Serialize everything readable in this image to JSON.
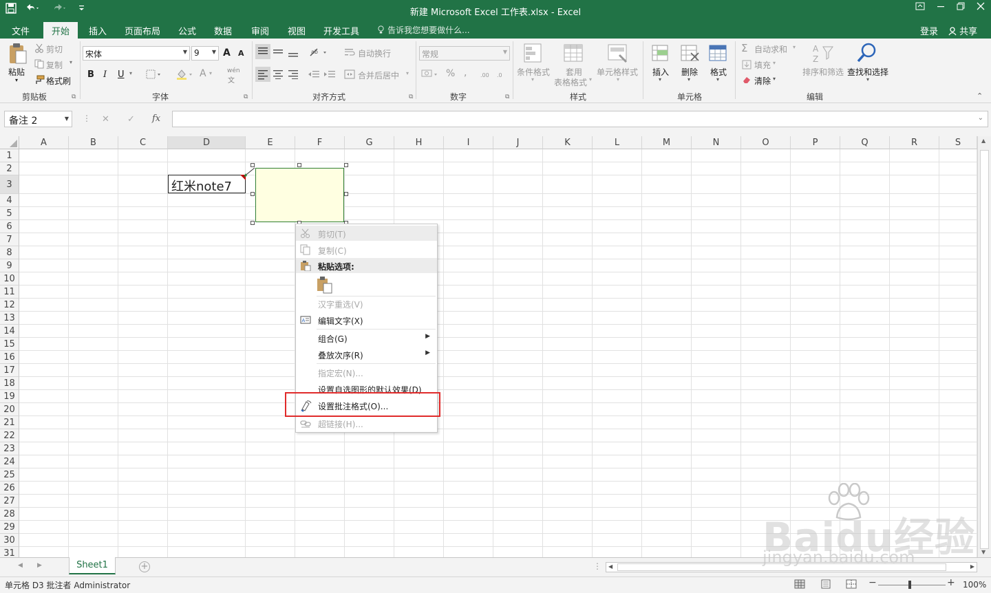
{
  "app": {
    "title": "新建 Microsoft Excel 工作表.xlsx - Excel",
    "quick_access": [
      "save-icon",
      "undo-icon",
      "redo-icon",
      "customize-icon"
    ]
  },
  "tabs": {
    "items": [
      "文件",
      "开始",
      "插入",
      "页面布局",
      "公式",
      "数据",
      "审阅",
      "视图",
      "开发工具"
    ],
    "active": "开始",
    "tell_me": "告诉我您想要做什么...",
    "login": "登录",
    "share": "共享"
  },
  "ribbon": {
    "clipboard": {
      "paste": "粘贴",
      "cut": "剪切",
      "copy": "复制",
      "format_painter": "格式刷",
      "label": "剪贴板"
    },
    "font": {
      "name": "宋体",
      "size": "9",
      "bold": "B",
      "italic": "I",
      "underline": "U",
      "grow": "A",
      "shrink": "A",
      "wen": "wén",
      "label": "字体"
    },
    "alignment": {
      "wrap": "自动换行",
      "merge": "合并后居中",
      "label": "对齐方式"
    },
    "number": {
      "format": "常规",
      "percent": "%",
      "comma": ",",
      "label": "数字"
    },
    "styles": {
      "conditional": "条件格式",
      "table_line1": "套用",
      "table_line2": "表格格式",
      "cell_styles": "单元格样式",
      "label": "样式"
    },
    "cells": {
      "insert": "插入",
      "delete": "删除",
      "format": "格式",
      "label": "单元格"
    },
    "editing": {
      "autosum": "自动求和",
      "fill": "填充",
      "clear": "清除",
      "sort": "排序和筛选",
      "find": "查找和选择",
      "label": "编辑"
    }
  },
  "formula_bar": {
    "name_box": "备注 2",
    "cancel": "✕",
    "enter": "✓",
    "fx": "fx",
    "value": ""
  },
  "grid": {
    "columns": [
      "A",
      "B",
      "C",
      "D",
      "E",
      "F",
      "G",
      "H",
      "I",
      "J",
      "K",
      "L",
      "M",
      "N",
      "O",
      "P",
      "Q",
      "R",
      "S"
    ],
    "rows": [
      "1",
      "2",
      "3",
      "4",
      "5",
      "6",
      "7",
      "8",
      "9",
      "10",
      "11",
      "12",
      "13",
      "14",
      "15",
      "16",
      "17",
      "18",
      "19",
      "20",
      "21",
      "22",
      "23",
      "24",
      "25",
      "26",
      "27",
      "28",
      "29",
      "30",
      "31"
    ],
    "cell_D3": "红米note7",
    "comment_text": ""
  },
  "context_menu": {
    "items": [
      {
        "label": "剪切(T)",
        "icon": "scissors-icon",
        "disabled": true
      },
      {
        "label": "复制(C)",
        "icon": "copy-icon",
        "disabled": true
      },
      {
        "label": "粘贴选项:",
        "icon": "paste-icon",
        "disabled": false,
        "header": true
      },
      {
        "label": "汉字重选(V)",
        "disabled": true
      },
      {
        "label": "编辑文字(X)",
        "icon": "edit-text-icon",
        "disabled": false
      },
      {
        "label": "组合(G)",
        "disabled": false,
        "submenu": true
      },
      {
        "label": "叠放次序(R)",
        "disabled": false,
        "submenu": true
      },
      {
        "label": "指定宏(N)...",
        "disabled": true
      },
      {
        "label": "设置自选图形的默认效果(D)",
        "disabled": false
      },
      {
        "label": "设置批注格式(O)...",
        "icon": "format-comment-icon",
        "disabled": false,
        "highlighted": true
      },
      {
        "label": "超链接(H)...",
        "icon": "link-icon",
        "disabled": true
      }
    ]
  },
  "sheets": {
    "tabs": [
      "Sheet1"
    ],
    "active": "Sheet1",
    "add": "+"
  },
  "status": {
    "text": "单元格 D3 批注者 Administrator",
    "zoom": "100%"
  },
  "watermark": {
    "line1": "Baidu经验",
    "line2": "jingyan.baidu.com"
  },
  "colors": {
    "excel_green": "#217346",
    "highlight_red": "#e02a2a",
    "comment_fill": "#ffffe1"
  }
}
